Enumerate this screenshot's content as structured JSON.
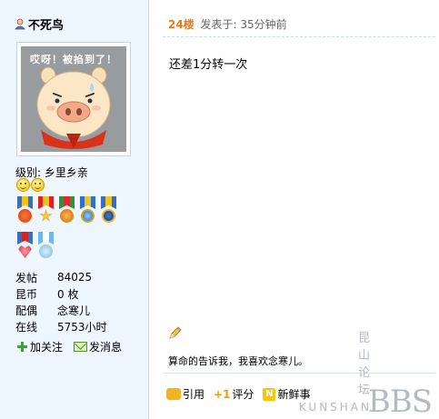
{
  "author": {
    "name": "不死鸟",
    "avatar_caption": "哎呀！被掐到了！"
  },
  "profile": {
    "level_label": "级别: 乡里乡亲",
    "stats": [
      {
        "label": "发帖",
        "value": "84025"
      },
      {
        "label": "昆币",
        "value": "0 枚"
      },
      {
        "label": "配偶",
        "value": "念寒儿"
      },
      {
        "label": "在线",
        "value": "5753小时"
      }
    ],
    "actions": {
      "follow": "加关注",
      "message": "发消息"
    }
  },
  "post": {
    "floor": "24楼",
    "posted_at": "发表于: 35分钟前",
    "content": "还差1分转一次",
    "signature": "算命的告诉我，我喜欢念寒儿。"
  },
  "post_actions": {
    "quote": "引用",
    "rate": "评分",
    "new": "新鲜事"
  },
  "icons": {
    "rate_glyph": "+1",
    "new_glyph": "N"
  },
  "watermark": {
    "top": "昆山论坛",
    "sub": "KUNSHAN",
    "big": "BBS"
  },
  "colors": {
    "floor": "#e87c1e",
    "sidebar_bg": "#eef6ff"
  }
}
